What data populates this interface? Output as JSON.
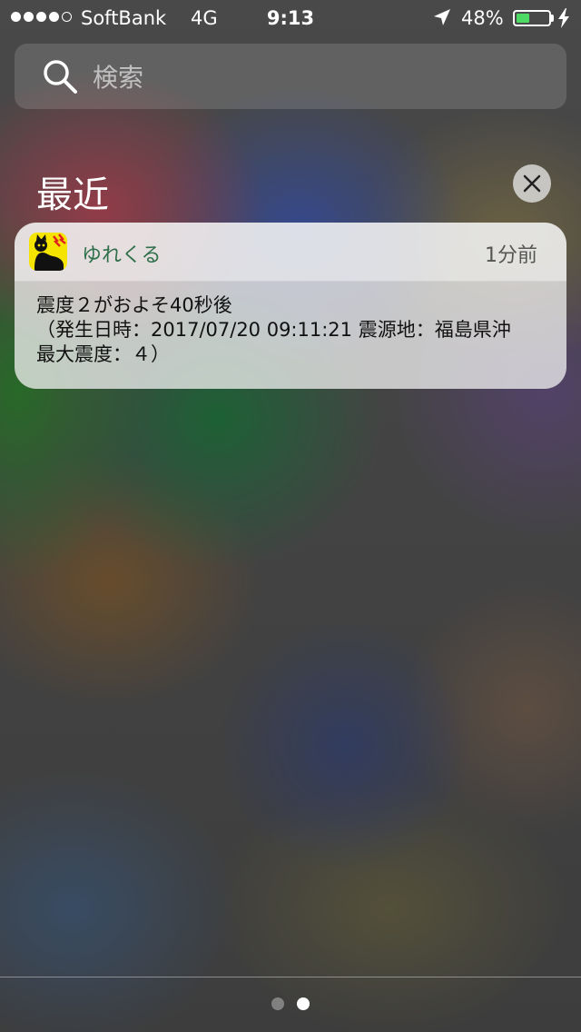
{
  "status_bar": {
    "carrier": "SoftBank",
    "network": "4G",
    "time": "9:13",
    "battery_percent_text": "48%",
    "battery_level": 0.48,
    "signal_bars_filled": 4,
    "signal_bars_total": 5,
    "battery_color": "#4cd964"
  },
  "search": {
    "placeholder": "検索",
    "value": ""
  },
  "recent": {
    "title": "最近"
  },
  "notification": {
    "app_name": "ゆれくる",
    "time_ago": "1分前",
    "message_lines": [
      "震度２がおよそ40秒後",
      "（発生日時：2017/07/20 09:11:21 震源地：福島県沖",
      "最大震度：４）"
    ]
  },
  "pager": {
    "page_count": 2,
    "current_page": 2
  },
  "icons": {
    "search": "search-icon",
    "location": "location-arrow-icon",
    "charging": "charging-bolt-icon",
    "clear": "close-icon",
    "app": "yurekuru-app-icon"
  }
}
